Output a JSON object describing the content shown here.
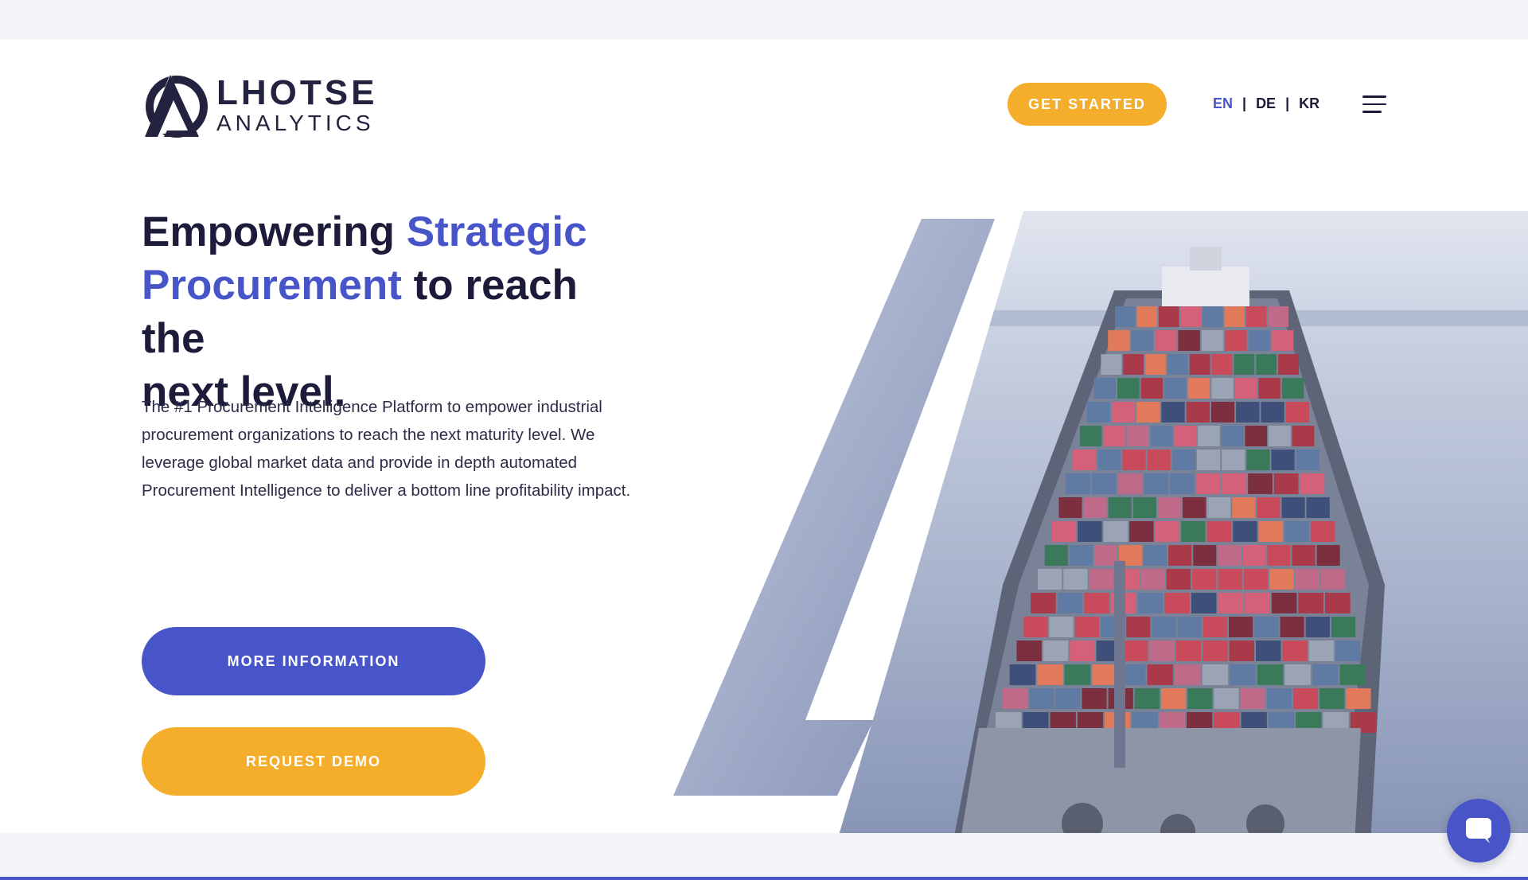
{
  "header": {
    "logo_top": "LHOTSE",
    "logo_bottom": "ANALYTICS",
    "get_started_label": "GET STARTED",
    "languages": [
      {
        "label": "EN",
        "active": true
      },
      {
        "label": "DE",
        "active": false
      },
      {
        "label": "KR",
        "active": false
      }
    ],
    "language_separator": "|",
    "menu_icon": "hamburger-menu-icon"
  },
  "hero": {
    "headline": {
      "part1": "Empowering ",
      "accent1": "Strategic",
      "accent2": "Procurement",
      "part2": " to reach the",
      "part3": "next level."
    },
    "description": "The #1 Procurement Intelligence Platform to empower industrial procurement organizations to reach the next maturity level. We leverage global market data and provide in depth automated Procurement Intelligence to deliver a bottom line profitability impact.",
    "more_info_label": "MORE INFORMATION",
    "request_demo_label": "REQUEST DEMO",
    "image": "container-ship-image"
  },
  "chat": {
    "icon": "chat-bubble-icon"
  },
  "colors": {
    "accent_blue": "#4755c9",
    "accent_orange": "#f5ae2b",
    "text_dark": "#1c1c3a"
  }
}
